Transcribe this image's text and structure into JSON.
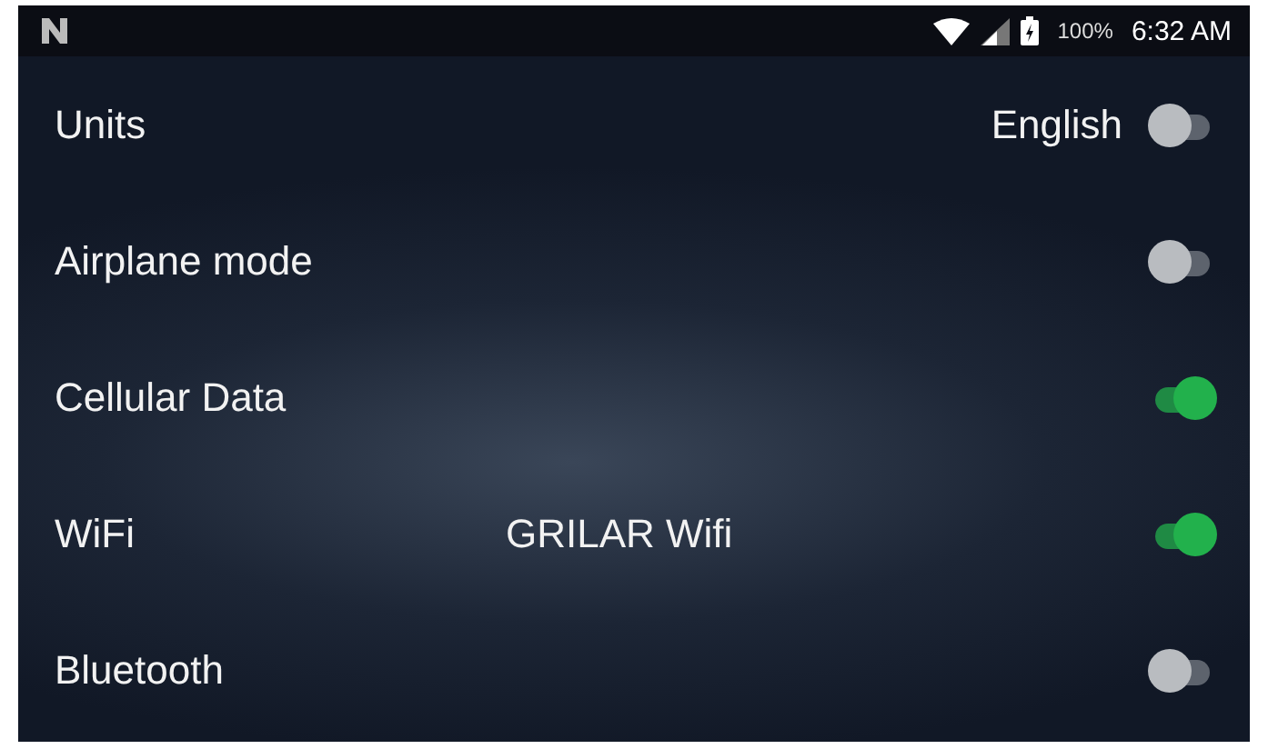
{
  "status_bar": {
    "battery": "100%",
    "time": "6:32 AM"
  },
  "settings": [
    {
      "label": "Units",
      "kind": "trailing",
      "value": "English",
      "on": false
    },
    {
      "label": "Airplane mode",
      "kind": "plain",
      "on": false
    },
    {
      "label": "Cellular Data",
      "kind": "plain",
      "on": true
    },
    {
      "label": "WiFi",
      "kind": "middle",
      "value": "GRILAR Wifi",
      "on": true
    },
    {
      "label": "Bluetooth",
      "kind": "plain",
      "on": false
    }
  ]
}
